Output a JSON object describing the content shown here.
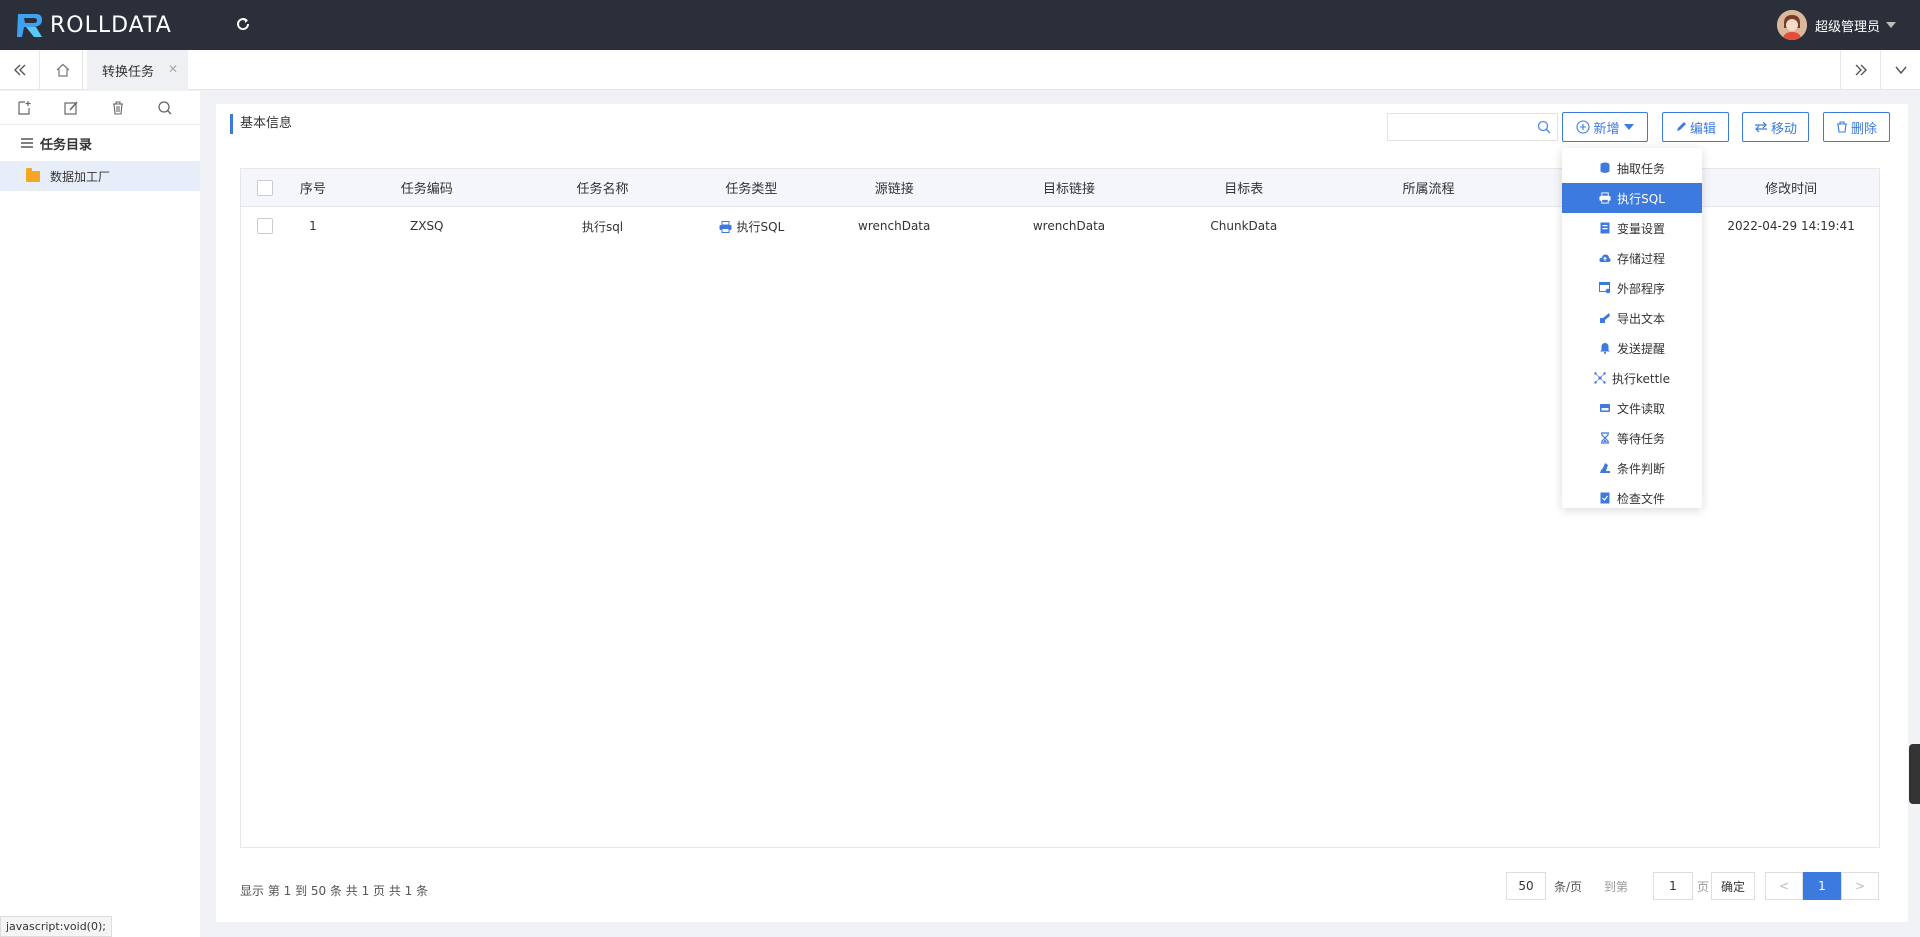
{
  "header": {
    "brand": "ROLLDATA",
    "user_name": "超级管理员"
  },
  "tabs": [
    {
      "label": "转换任务"
    }
  ],
  "sidebar": {
    "tree_title": "任务目录",
    "nodes": [
      {
        "label": "数据加工厂"
      }
    ]
  },
  "panel": {
    "title": "基本信息",
    "search_placeholder": "",
    "buttons": {
      "add": "新增",
      "edit": "编辑",
      "move": "移动",
      "delete": "删除"
    }
  },
  "table": {
    "columns": [
      "序号",
      "任务编码",
      "任务名称",
      "任务类型",
      "源链接",
      "目标链接",
      "目标表",
      "所属流程",
      "",
      "修改时间"
    ],
    "rows": [
      {
        "index": "1",
        "code": "ZXSQ",
        "name": "执行sql",
        "type": "执行SQL",
        "source": "wrenchData",
        "target": "wrenchData",
        "target_table": "ChunkData",
        "flow": "",
        "hidden": "",
        "modified": "2022-04-29 14:19:41"
      }
    ]
  },
  "dropdown": {
    "items": [
      {
        "label": "抽取任务",
        "icon": "database-icon"
      },
      {
        "label": "执行SQL",
        "icon": "printer-icon",
        "active": true
      },
      {
        "label": "变量设置",
        "icon": "variable-icon"
      },
      {
        "label": "存储过程",
        "icon": "cloud-upload-icon"
      },
      {
        "label": "外部程序",
        "icon": "window-gear-icon"
      },
      {
        "label": "导出文本",
        "icon": "export-icon"
      },
      {
        "label": "发送提醒",
        "icon": "bell-icon"
      },
      {
        "label": "执行kettle",
        "icon": "kettle-icon"
      },
      {
        "label": "文件读取",
        "icon": "file-read-icon"
      },
      {
        "label": "等待任务",
        "icon": "hourglass-icon"
      },
      {
        "label": "条件判断",
        "icon": "condition-icon"
      },
      {
        "label": "检查文件",
        "icon": "check-file-icon"
      }
    ]
  },
  "pagination": {
    "info": "显示 第 1 到 50 条 共 1 页 共 1 条",
    "page_size": "50",
    "per_page_label": "条/页",
    "goto_label": "到第",
    "goto_value": "1",
    "page_label": "页",
    "confirm": "确定",
    "prev": "<",
    "current": "1",
    "next": ">"
  },
  "status_bar": "javascript:void(0);",
  "colors": {
    "topbar": "#2b2f3a",
    "accent": "#3d7ae0",
    "folder": "#f5a623"
  }
}
